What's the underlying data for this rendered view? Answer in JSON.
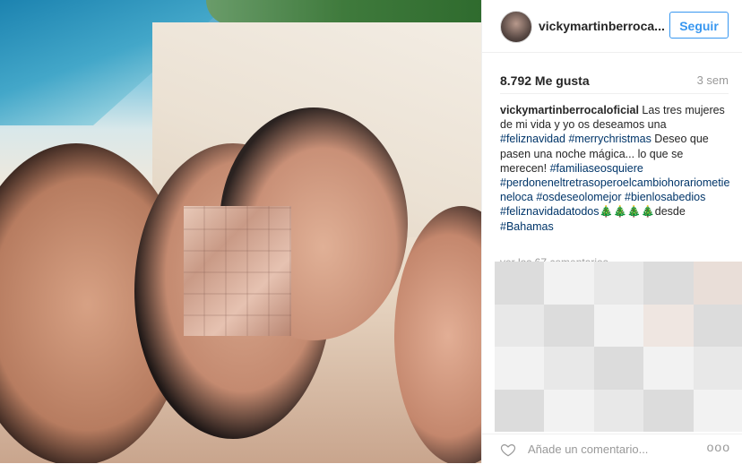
{
  "post": {
    "username": "vickymartinberroca...",
    "follow_label": "Seguir",
    "likes": "8.792 Me gusta",
    "time": "3 sem",
    "caption": {
      "author": "vickymartinberrocaloficial",
      "text1": " Las tres mujeres de mi vida y yo os deseamos una ",
      "tag1": "#feliznavidad",
      "tag2": "#merrychristmas",
      "text2": " Deseo que pasen una noche mágica... lo que se merecen! ",
      "tag3": "#familiaseosquiere",
      "tag4": "#perdoneneltretrasoperoelcambiohorariometieneloca",
      "tag5": "#osdeseolomejor",
      "tag6": "#bienlosabedios",
      "tag7": "#feliznavidadatodos",
      "emoji": "🎄🎄🎄🎄",
      "text3": "desde ",
      "tag8": "#Bahamas"
    },
    "more_comments": "ver los 67 comentarios",
    "comment_placeholder": "Añade un comentario...",
    "options": "ooo"
  }
}
